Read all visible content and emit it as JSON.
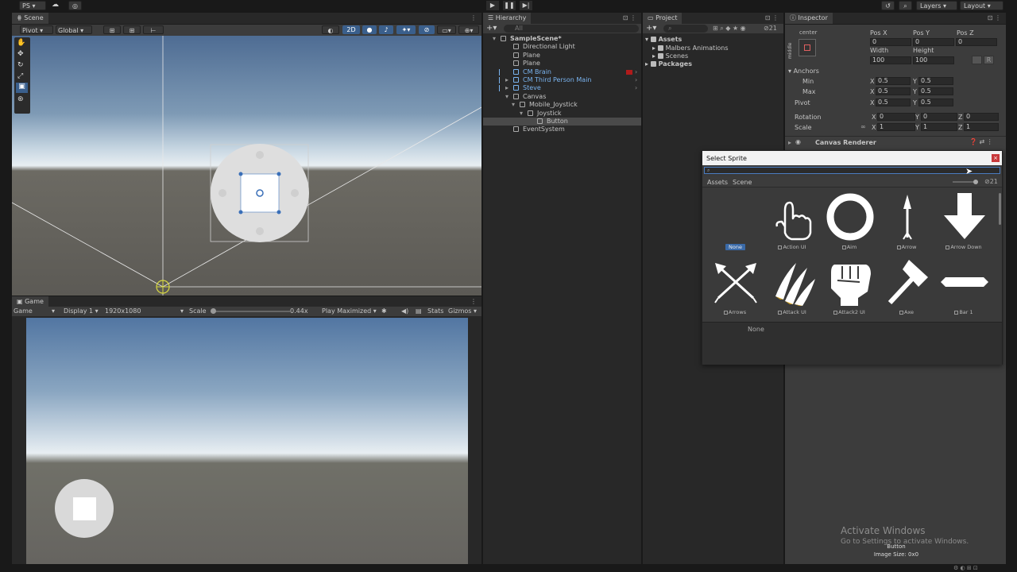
{
  "topbar": {
    "account": "PS",
    "layers": "Layers",
    "layout": "Layout"
  },
  "scene": {
    "tab": "Scene",
    "pivot": "Pivot",
    "global": "Global",
    "mode2d": "2D"
  },
  "game": {
    "tab": "Game",
    "display_mode": "Game",
    "display": "Display 1",
    "resolution": "1920x1080",
    "scale_label": "Scale",
    "scale_value": "0.44x",
    "play_mode": "Play Maximized",
    "stats": "Stats",
    "gizmos": "Gizmos"
  },
  "hierarchy": {
    "tab": "Hierarchy",
    "search_placeholder": "All",
    "items": [
      {
        "label": "SampleScene*",
        "blue": false
      },
      {
        "label": "Directional Light",
        "blue": false
      },
      {
        "label": "Plane",
        "blue": false
      },
      {
        "label": "Plane",
        "blue": false
      },
      {
        "label": "CM Brain",
        "blue": true
      },
      {
        "label": "CM Third Person Main",
        "blue": true
      },
      {
        "label": "Steve",
        "blue": true
      },
      {
        "label": "Canvas",
        "blue": false
      },
      {
        "label": "Mobile_Joystick",
        "blue": false
      },
      {
        "label": "Joystick",
        "blue": false
      },
      {
        "label": "Button",
        "blue": false
      },
      {
        "label": "EventSystem",
        "blue": false
      }
    ]
  },
  "project": {
    "tab": "Project",
    "count": "21",
    "items": [
      "Assets",
      "Malbers Animations",
      "Scenes",
      "Packages"
    ]
  },
  "inspector": {
    "tab": "Inspector",
    "anchor_preset": "center",
    "anchor_side": "middle",
    "pos_x_label": "Pos X",
    "pos_y_label": "Pos Y",
    "pos_z_label": "Pos Z",
    "pos_x": "0",
    "pos_y": "0",
    "pos_z": "0",
    "width_label": "Width",
    "height_label": "Height",
    "width": "100",
    "height": "100",
    "anchors_label": "Anchors",
    "min_label": "Min",
    "max_label": "Max",
    "pivot_label": "Pivot",
    "min_x": "0.5",
    "min_y": "0.5",
    "max_x": "0.5",
    "max_y": "0.5",
    "pivot_x": "0.5",
    "pivot_y": "0.5",
    "rotation_label": "Rotation",
    "scale_label": "Scale",
    "rot_x": "0",
    "rot_y": "0",
    "rot_z": "0",
    "scale_x": "1",
    "scale_y": "1",
    "scale_z": "1",
    "x": "X",
    "y": "Y",
    "z": "Z",
    "component": "Canvas Renderer",
    "preview_name": "Button",
    "preview_size": "Image Size: 0x0"
  },
  "select_sprite": {
    "title": "Select Sprite",
    "tab_assets": "Assets",
    "tab_scene": "Scene",
    "count": "21",
    "preview_label": "None",
    "sprites": [
      {
        "name": "None",
        "icon": "none"
      },
      {
        "name": "Action UI",
        "icon": "hand-pointer-icon"
      },
      {
        "name": "Aim",
        "icon": "ring-icon"
      },
      {
        "name": "Arrow",
        "icon": "arrow-up-icon"
      },
      {
        "name": "Arrow Down",
        "icon": "arrow-down-icon"
      },
      {
        "name": "Arrows",
        "icon": "crossed-arrows-icon"
      },
      {
        "name": "Attack UI",
        "icon": "claw-icon"
      },
      {
        "name": "Attack2 UI",
        "icon": "fist-icon"
      },
      {
        "name": "Axe",
        "icon": "axe-icon"
      },
      {
        "name": "Bar 1",
        "icon": "bar-icon"
      }
    ]
  },
  "watermark": {
    "line1": "Activate Windows",
    "line2": "Go to Settings to activate Windows."
  }
}
